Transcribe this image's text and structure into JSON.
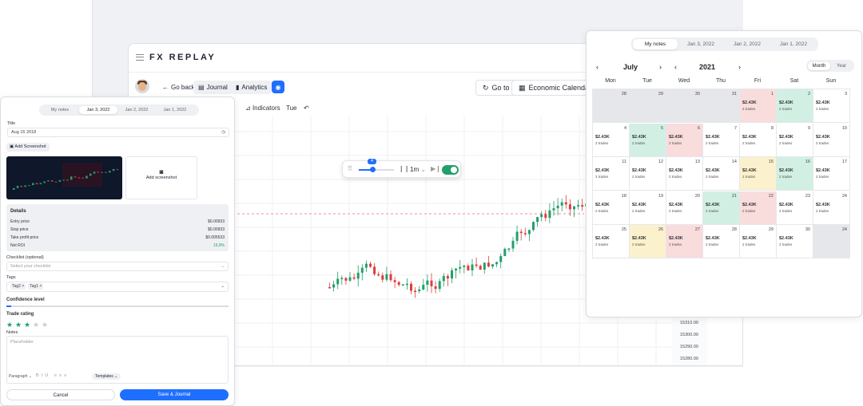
{
  "brand": {
    "logo": "FX REPLAY"
  },
  "toolbar": {
    "go_back": "Go back",
    "journal": "Journal",
    "analytics": "Analytics",
    "go_to": "Go to",
    "economic_calendar": "Economic Calendar",
    "indicators": "Indicators",
    "tue": "Tue"
  },
  "chart": {
    "price_labels": [
      "15310.00",
      "15300.00",
      "15290.00",
      "15280.00"
    ],
    "colors": {
      "up": "#22a06b",
      "down": "#e03c3c",
      "ref_line": "#e57373"
    }
  },
  "replay": {
    "speed_value": "4",
    "timeframe": "1m",
    "toggle_on": true
  },
  "journal_form": {
    "tabs": [
      {
        "label": "My notes",
        "active": false
      },
      {
        "label": "Jan 3, 2022",
        "active": true
      },
      {
        "label": "Jan 2, 2022",
        "active": false
      },
      {
        "label": "Jan 1, 2022",
        "active": false
      }
    ],
    "title_label": "Title",
    "title_value": "Aug 15 2018",
    "add_screenshot_button": "Add Screenshot",
    "add_screenshot_tile": "Add screenshot",
    "details": {
      "heading": "Details",
      "rows": [
        {
          "label": "Entry price",
          "value": "$0.00933"
        },
        {
          "label": "Stop price",
          "value": "$0.00933"
        },
        {
          "label": "Take profit price",
          "value": "$0.005533"
        },
        {
          "label": "Net ROI",
          "value": "19,9%"
        }
      ]
    },
    "checklist_label": "Checklist (optional)",
    "checklist_placeholder": "Select your checklist",
    "tags_label": "Tags",
    "tags": [
      "Tag2",
      "Tag1"
    ],
    "confidence_label": "Confidence level",
    "confidence_value": 0.02,
    "rating_label": "Trade rating",
    "rating_value": 3,
    "rating_max": 5,
    "notes_label": "Notes",
    "notes_placeholder": "Placeholder",
    "editor_style": "Paragraph",
    "templates_chip": "Templates",
    "cancel_button": "Cancel",
    "save_button": "Save & Journal"
  },
  "calendar": {
    "tabs": [
      {
        "label": "My notes",
        "active": true
      },
      {
        "label": "Jan 3, 2022",
        "active": false
      },
      {
        "label": "Jan 2, 2022",
        "active": false
      },
      {
        "label": "Jan 1, 2022",
        "active": false
      }
    ],
    "month": "July",
    "year": "2021",
    "view_toggle": [
      {
        "label": "Month",
        "active": true
      },
      {
        "label": "Year",
        "active": false
      }
    ],
    "weekdays": [
      "Mon",
      "Tue",
      "Wed",
      "Thu",
      "Fri",
      "Sat",
      "Sun"
    ],
    "cells": [
      {
        "day": "28",
        "state": "grey",
        "pnl": "",
        "trades": ""
      },
      {
        "day": "29",
        "state": "grey",
        "pnl": "",
        "trades": ""
      },
      {
        "day": "30",
        "state": "grey",
        "pnl": "",
        "trades": ""
      },
      {
        "day": "31",
        "state": "grey",
        "pnl": "",
        "trades": ""
      },
      {
        "day": "1",
        "state": "red",
        "pnl": "$2.43K",
        "trades": "2 trades"
      },
      {
        "day": "2",
        "state": "green",
        "pnl": "$2.43K",
        "trades": "2 trades"
      },
      {
        "day": "3",
        "state": "white",
        "pnl": "$2.43K",
        "trades": "2 trades"
      },
      {
        "day": "4",
        "state": "white",
        "pnl": "$2.43K",
        "trades": "2 trades"
      },
      {
        "day": "5",
        "state": "green",
        "pnl": "$2.43K",
        "trades": "2 trades"
      },
      {
        "day": "6",
        "state": "red",
        "pnl": "$2.43K",
        "trades": "2 trades"
      },
      {
        "day": "7",
        "state": "white",
        "pnl": "$2.43K",
        "trades": "2 trades"
      },
      {
        "day": "8",
        "state": "white",
        "pnl": "$2.43K",
        "trades": "2 trades"
      },
      {
        "day": "9",
        "state": "white",
        "pnl": "$2.43K",
        "trades": "2 trades"
      },
      {
        "day": "10",
        "state": "white",
        "pnl": "$2.43K",
        "trades": "2 trades"
      },
      {
        "day": "11",
        "state": "white",
        "pnl": "$2.43K",
        "trades": "2 trades"
      },
      {
        "day": "12",
        "state": "white",
        "pnl": "$2.43K",
        "trades": "2 trades"
      },
      {
        "day": "13",
        "state": "white",
        "pnl": "$2.43K",
        "trades": "2 trades"
      },
      {
        "day": "14",
        "state": "white",
        "pnl": "$2.43K",
        "trades": "2 trades"
      },
      {
        "day": "15",
        "state": "yellow",
        "pnl": "$2.43K",
        "trades": "2 trades"
      },
      {
        "day": "16",
        "state": "green",
        "pnl": "$2.43K",
        "trades": "2 trades"
      },
      {
        "day": "17",
        "state": "white",
        "pnl": "$2.43K",
        "trades": "2 trades"
      },
      {
        "day": "18",
        "state": "white",
        "pnl": "$2.43K",
        "trades": "2 trades"
      },
      {
        "day": "19",
        "state": "white",
        "pnl": "$2.43K",
        "trades": "2 trades"
      },
      {
        "day": "20",
        "state": "white",
        "pnl": "$2.43K",
        "trades": "2 trades"
      },
      {
        "day": "21",
        "state": "green",
        "pnl": "$2.43K",
        "trades": "2 trades"
      },
      {
        "day": "22",
        "state": "red",
        "pnl": "$2.43K",
        "trades": "2 trades"
      },
      {
        "day": "23",
        "state": "white",
        "pnl": "$2.43K",
        "trades": "2 trades"
      },
      {
        "day": "24",
        "state": "white",
        "pnl": "$2.43K",
        "trades": "2 trades"
      },
      {
        "day": "25",
        "state": "white",
        "pnl": "$2.43K",
        "trades": "2 trades"
      },
      {
        "day": "26",
        "state": "yellow",
        "pnl": "$2.43K",
        "trades": "2 trades"
      },
      {
        "day": "27",
        "state": "red",
        "pnl": "$2.43K",
        "trades": "2 trades"
      },
      {
        "day": "28",
        "state": "white",
        "pnl": "$2.43K",
        "trades": "2 trades"
      },
      {
        "day": "29",
        "state": "white",
        "pnl": "$2.43K",
        "trades": "2 trades"
      },
      {
        "day": "30",
        "state": "white",
        "pnl": "$2.43K",
        "trades": "2 trades"
      },
      {
        "day": "24",
        "state": "grey",
        "pnl": "",
        "trades": ""
      }
    ]
  }
}
